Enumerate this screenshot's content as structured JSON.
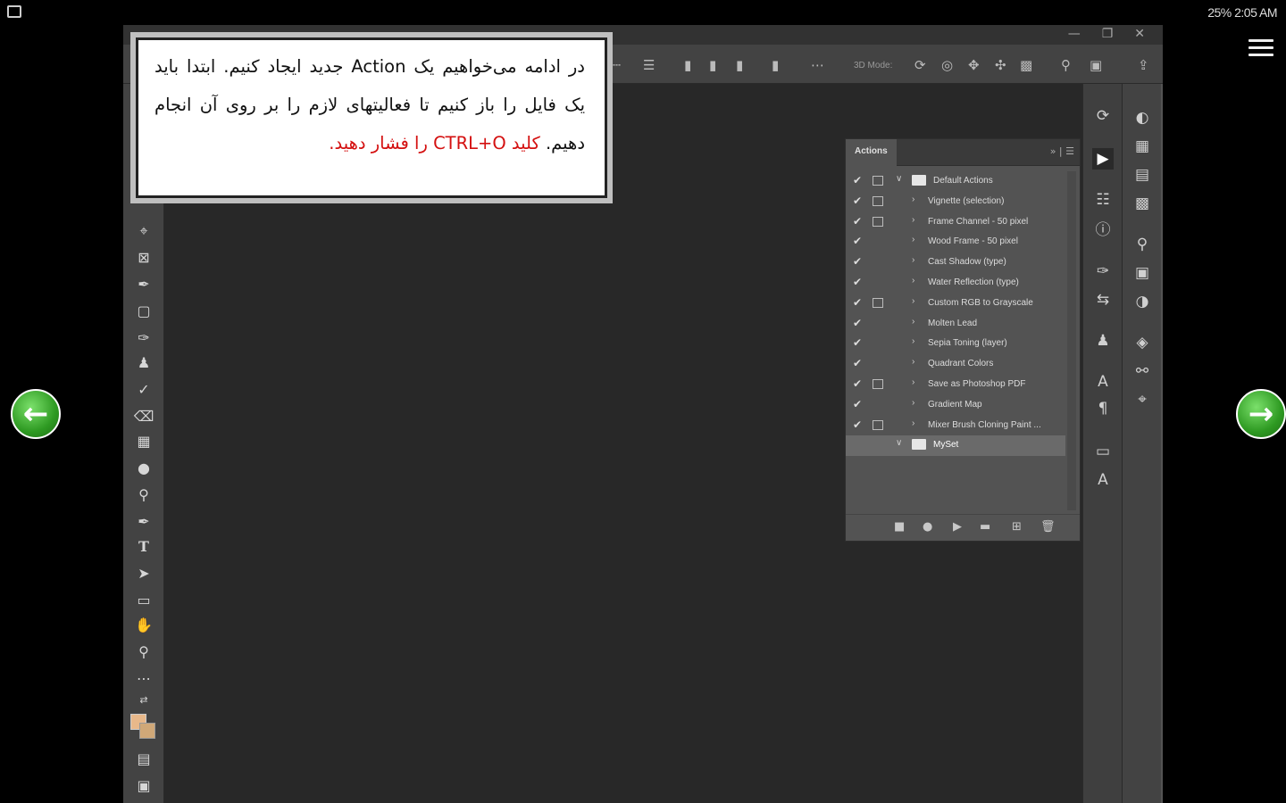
{
  "status_bar": {
    "right_text": "25% 2:05 AM"
  },
  "callout": {
    "line1": "در ادامه می‌خواهیم یک Action جدید ایجاد کنیم. ابتدا باید یک فایل را باز کنیم تا فعالیتهای لازم را بر روی آن انجام دهیم.",
    "line2_red": "کلید CTRL+O را فشار دهید."
  },
  "options_bar": {
    "mode_label": "3D Mode:"
  },
  "actions_panel": {
    "tab_label": "Actions",
    "items": [
      {
        "label": "Default Actions",
        "type": "set",
        "checked": true,
        "dialog": true
      },
      {
        "label": "Vignette (selection)",
        "type": "action",
        "checked": true,
        "dialog": true
      },
      {
        "label": "Frame Channel - 50 pixel",
        "type": "action",
        "checked": true,
        "dialog": true
      },
      {
        "label": "Wood Frame - 50 pixel",
        "type": "action",
        "checked": true,
        "dialog": false
      },
      {
        "label": "Cast Shadow (type)",
        "type": "action",
        "checked": true,
        "dialog": false
      },
      {
        "label": "Water Reflection (type)",
        "type": "action",
        "checked": true,
        "dialog": false
      },
      {
        "label": "Custom RGB to Grayscale",
        "type": "action",
        "checked": true,
        "dialog": true
      },
      {
        "label": "Molten Lead",
        "type": "action",
        "checked": true,
        "dialog": false
      },
      {
        "label": "Sepia Toning (layer)",
        "type": "action",
        "checked": true,
        "dialog": false
      },
      {
        "label": "Quadrant Colors",
        "type": "action",
        "checked": true,
        "dialog": false
      },
      {
        "label": "Save as Photoshop PDF",
        "type": "action",
        "checked": true,
        "dialog": true
      },
      {
        "label": "Gradient Map",
        "type": "action",
        "checked": true,
        "dialog": false
      },
      {
        "label": "Mixer Brush Cloning Paint ...",
        "type": "action",
        "checked": true,
        "dialog": true
      },
      {
        "label": "MySet",
        "type": "set",
        "checked": false,
        "dialog": false,
        "selected": true
      }
    ]
  },
  "colors": {
    "foreground": "#e8b88a",
    "background": "#d0a878",
    "accent_red": "#d41010"
  }
}
